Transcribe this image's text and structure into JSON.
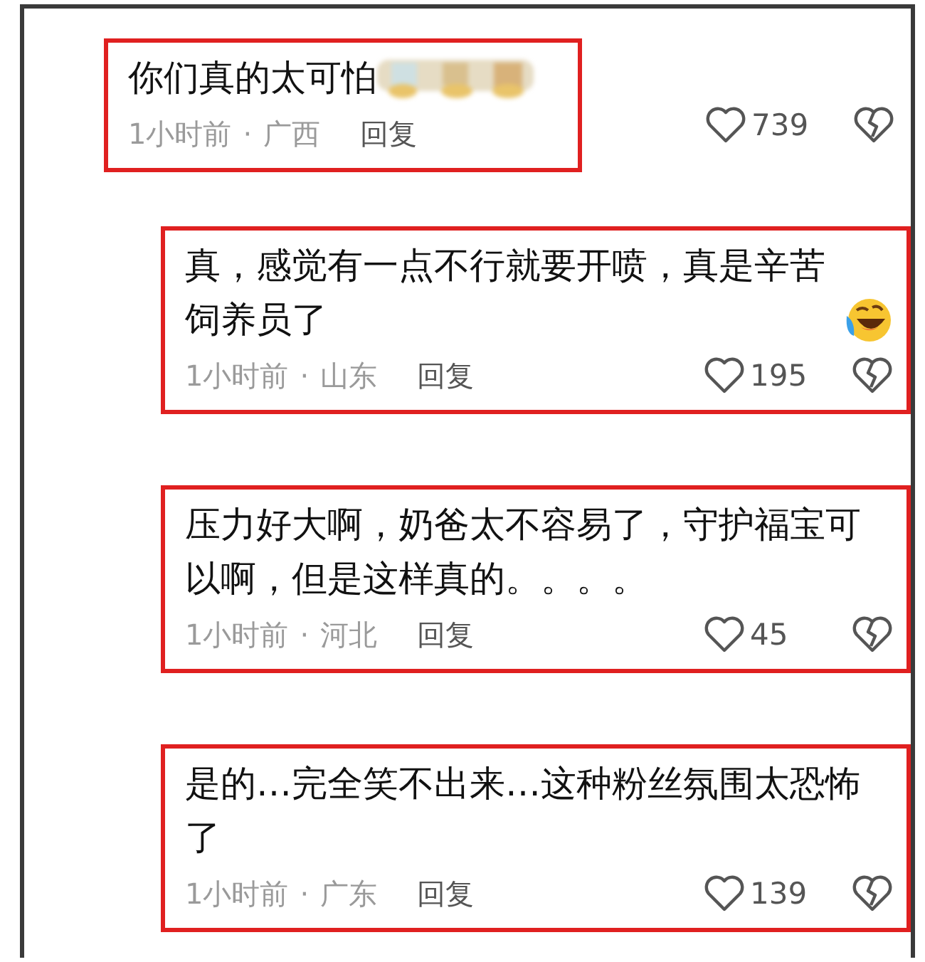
{
  "comments": [
    {
      "text": "你们真的太可怕",
      "kind": "blurred-emoji",
      "highlighted": true,
      "time": "1小时前",
      "separator": "·",
      "location": "广西",
      "reply": "回复",
      "likes": "739",
      "replies": [
        {
          "text": "真，感觉有一点不行就要开喷，真是辛苦饲养员了",
          "kind": "emoji",
          "highlighted": true,
          "time": "1小时前",
          "separator": "·",
          "location": "山东",
          "reply": "回复",
          "likes": "195"
        },
        {
          "text": "压力好大啊，奶爸太不容易了，守护福宝可以啊，但是这样真的。。。。",
          "highlighted": true,
          "time": "1小时前",
          "separator": "·",
          "location": "河北",
          "reply": "回复",
          "likes": "45"
        },
        {
          "text": "是的…完全笑不出来…这种粉丝氛围太恐怖了",
          "highlighted": true,
          "time": "1小时前",
          "separator": "·",
          "location": "广东",
          "reply": "回复",
          "likes": "139"
        }
      ]
    }
  ]
}
